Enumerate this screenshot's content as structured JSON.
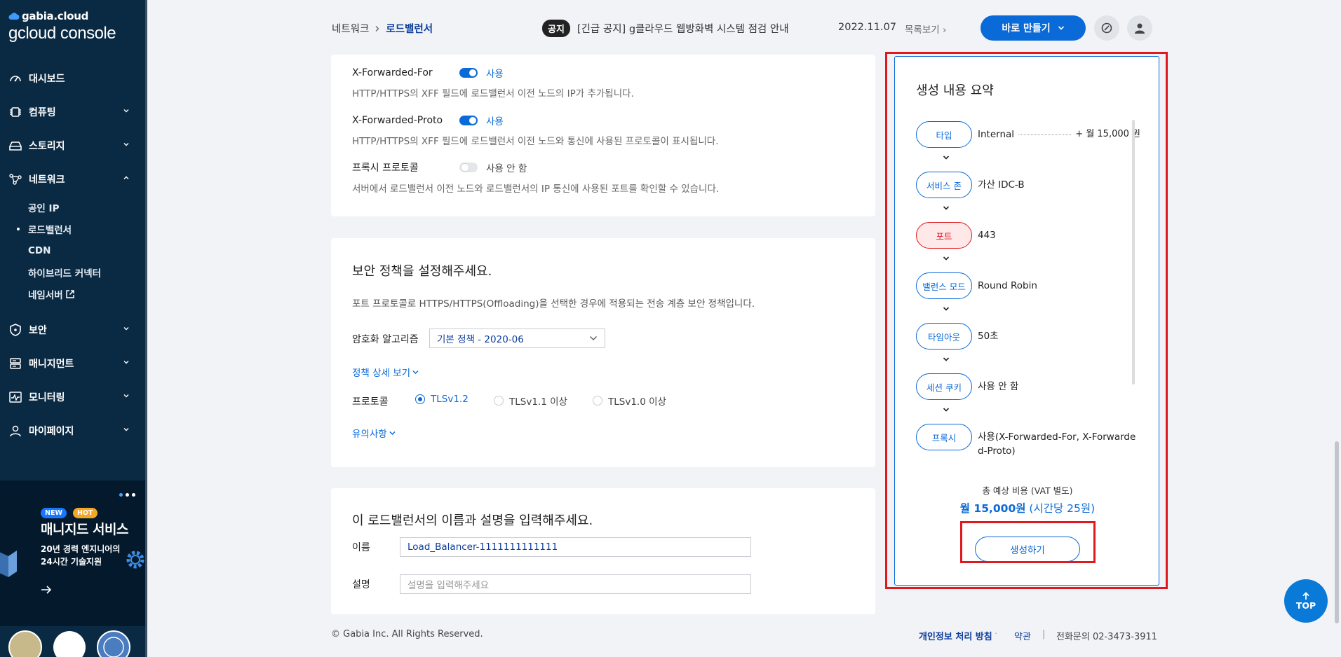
{
  "sidebar": {
    "logo_top": "gabia.cloud",
    "logo_main": "gcloud console",
    "items": [
      {
        "label": "대시보드",
        "icon": "dashboard-icon"
      },
      {
        "label": "컴퓨팅",
        "icon": "chip-icon"
      },
      {
        "label": "스토리지",
        "icon": "storage-icon"
      },
      {
        "label": "네트워크",
        "icon": "network-icon"
      },
      {
        "label": "보안",
        "icon": "shield-icon"
      },
      {
        "label": "매니지먼트",
        "icon": "management-icon"
      },
      {
        "label": "모니터링",
        "icon": "monitoring-icon"
      },
      {
        "label": "마이페이지",
        "icon": "user-icon"
      }
    ],
    "network_sub": [
      "공인 IP",
      "로드밸런서",
      "CDN",
      "하이브리드 커넥터",
      "네임서버"
    ],
    "promo": {
      "badge_new": "NEW",
      "badge_hot": "HOT",
      "title": "매니지드 서비스",
      "desc_line1": "20년 경력 엔지니어의",
      "desc_line2": "24시간 기술지원"
    }
  },
  "header": {
    "breadcrumb_root": "네트워크",
    "breadcrumb_current": "로드밸런서",
    "notice_tag": "공지",
    "notice_text": "[긴급 공지] g클라우드 웹방화벽 시스템 점검 안내",
    "notice_date": "2022.11.07",
    "notice_list": "목록보기",
    "make_button": "바로 만들기"
  },
  "proxy": {
    "xff_label": "X-Forwarded-For",
    "xff_state": "사용",
    "xff_desc": "HTTP/HTTPS의 XFF 필드에 로드밸런서 이전 노드의 IP가 추가됩니다.",
    "xfp_label": "X-Forwarded-Proto",
    "xfp_state": "사용",
    "xfp_desc": "HTTP/HTTPS의 XFF 필드에 로드밸런서 이전 노드와 통신에 사용된 프로토콜이 표시됩니다.",
    "pp_label": "프록시 프로토콜",
    "pp_state": "사용 안 함",
    "pp_desc": "서버에서 로드밸런서 이전 노드와 로드밸런서의 IP 통신에 사용된 포트를 확인할 수 있습니다."
  },
  "security": {
    "title": "보안 정책을 설정해주세요.",
    "desc": "포트 프로토콜로 HTTPS/HTTPS(Offloading)을 선택한 경우에 적용되는 전송 계층 보안 정책입니다.",
    "algo_label": "암호화 알고리즘",
    "algo_value": "기본 정책 - 2020-06",
    "detail_link": "정책 상세 보기",
    "protocol_label": "프로토콜",
    "protocols": [
      "TLSv1.2",
      "TLSv1.1 이상",
      "TLSv1.0 이상"
    ],
    "protocol_selected": "TLSv1.2",
    "notice_link": "유의사항"
  },
  "naming": {
    "title": "이 로드밸런서의 이름과 설명을 입력해주세요.",
    "name_label": "이름",
    "name_value": "Load_Balancer-1111111111111",
    "desc_label": "설명",
    "desc_placeholder": "설명을 입력해주세요"
  },
  "footer": {
    "copyright": "© Gabia Inc. All Rights Reserved.",
    "privacy": "개인정보 처리 방침",
    "terms": "약관",
    "phone": "전화문의  02-3473-3911"
  },
  "summary": {
    "title": "생성 내용 요약",
    "steps": [
      {
        "tag": "타입",
        "value": "Internal",
        "price": "+ 월 15,000 원"
      },
      {
        "tag": "서비스 존",
        "value": "가산 IDC-B"
      },
      {
        "tag": "포트",
        "value": "443"
      },
      {
        "tag": "밸런스 모드",
        "value": "Round Robin"
      },
      {
        "tag": "타임아웃",
        "value": "50초"
      },
      {
        "tag": "세션 쿠키",
        "value": "사용 안 함"
      },
      {
        "tag": "프록시",
        "value": "사용(X-Forwarded-For, X-Forwarded-Proto)"
      }
    ],
    "total_label": "총 예상 비용 (VAT 별도)",
    "total_value": "월 15,000원 (시간당 25원)",
    "create_button": "생성하기"
  },
  "top_button": "TOP",
  "colors": {
    "accent": "#0a6ad8",
    "sidebar": "#0a2a43",
    "highlight": "#e0191e"
  }
}
